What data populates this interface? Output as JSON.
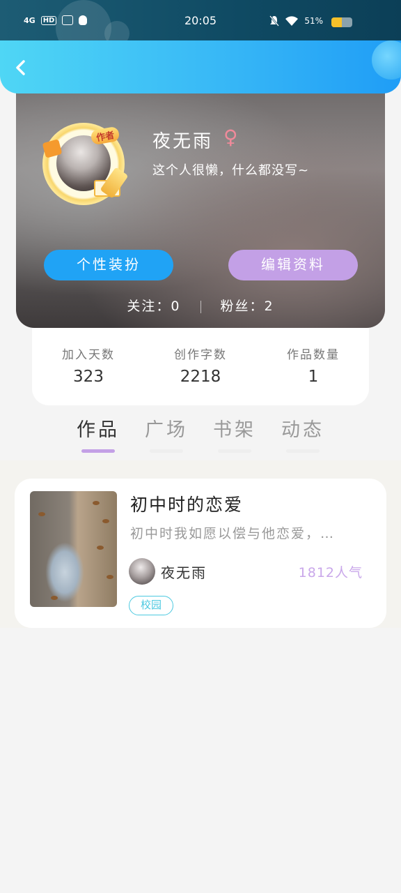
{
  "status_bar": {
    "signal": "4G",
    "hd": "HD",
    "time": "20:05",
    "battery_text": "51%",
    "battery_level": 0.51
  },
  "header": {
    "back_icon": "chevron-left-icon"
  },
  "profile": {
    "author_badge": "作者",
    "username": "夜无雨",
    "gender_symbol": "♀",
    "bio": "这个人很懒，什么都没写~",
    "dress_button": "个性装扮",
    "edit_button": "编辑资料",
    "following": "关注：0",
    "followers": "粉丝：2"
  },
  "stats": [
    {
      "label": "加入天数",
      "value": "323"
    },
    {
      "label": "创作字数",
      "value": "2218"
    },
    {
      "label": "作品数量",
      "value": "1"
    }
  ],
  "tabs": [
    {
      "label": "作品",
      "active": true
    },
    {
      "label": "广场",
      "active": false
    },
    {
      "label": "书架",
      "active": false
    },
    {
      "label": "动态",
      "active": false
    }
  ],
  "works": [
    {
      "title": "初中时的恋爱",
      "description": "初中时我如愿以偿与他恋爱，…",
      "author": "夜无雨",
      "popularity": "1812人气",
      "tag": "校园"
    }
  ],
  "colors": {
    "accent_blue": "#20a3f5",
    "accent_purple": "#c3a0e6",
    "tag_cyan": "#4cc9e0"
  }
}
